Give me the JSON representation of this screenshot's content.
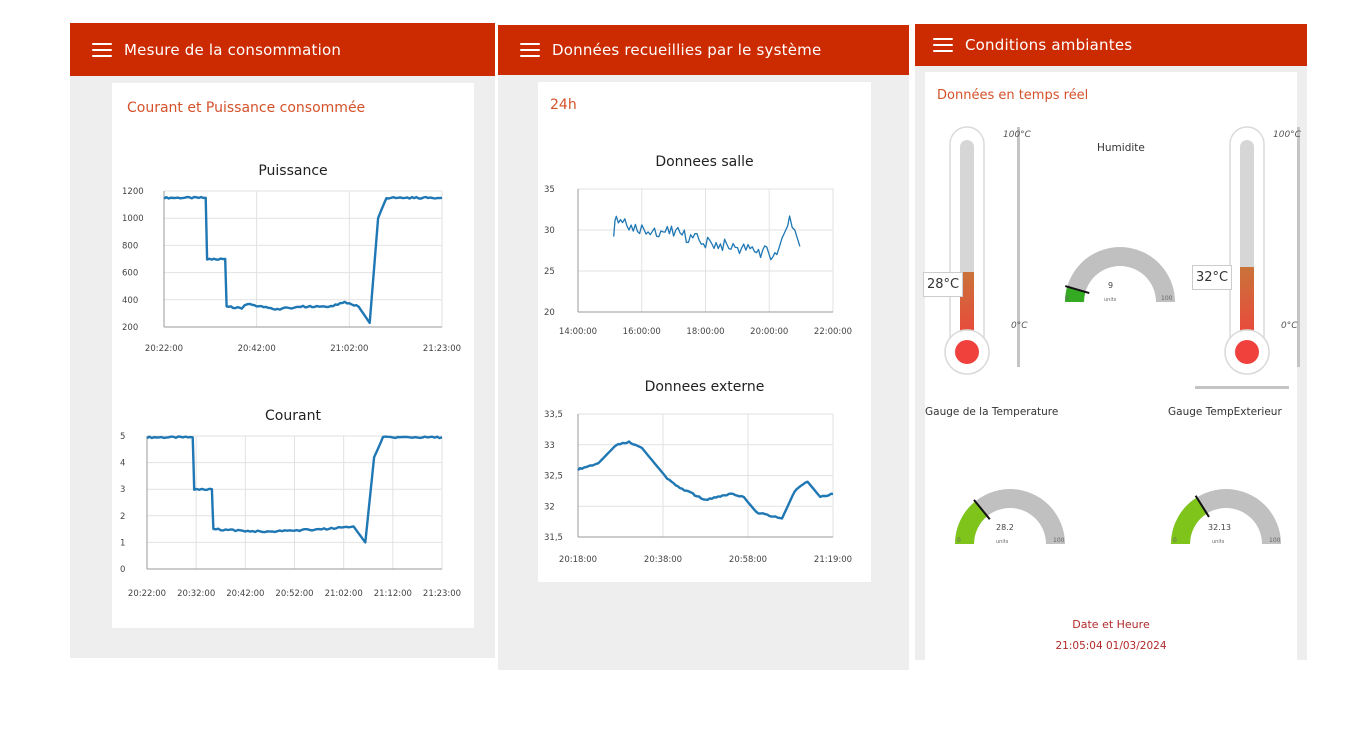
{
  "panels": [
    {
      "toolbar": {
        "title": "Mesure de la consommation"
      },
      "card_title": "Courant et Puissance consommée",
      "charts": [
        "Puissance",
        "Courant"
      ]
    },
    {
      "toolbar": {
        "title": "Données recueillies par le système"
      },
      "card_title": "24h",
      "charts": [
        "Donnees salle",
        "Donnees externe"
      ]
    },
    {
      "toolbar": {
        "title": "Conditions ambiantes"
      },
      "card_title": "Données en temps réel",
      "thermometers": [
        {
          "label": "28°C",
          "value": 28,
          "max_label": "100°C",
          "min_label": "0°C"
        },
        {
          "label": "32°C",
          "value": 32,
          "max_label": "100°C",
          "min_label": "0°C"
        }
      ],
      "gauges": [
        {
          "title": "Humidite",
          "value": "9",
          "units": "units",
          "min": "0",
          "max": "100",
          "color": "#33aa22"
        },
        {
          "title": "Gauge de la Temperature",
          "value": "28.2",
          "units": "units",
          "min": "0",
          "max": "100",
          "color": "#7fc41a"
        },
        {
          "title": "Gauge TempExterieur",
          "value": "32.13",
          "units": "units",
          "min": "0",
          "max": "100",
          "color": "#7fc41a"
        }
      ],
      "datetime": {
        "label": "Date et Heure",
        "value": "21:05:04 01/03/2024"
      }
    }
  ],
  "colors": {
    "toolbar": "#cc2a00",
    "accent": "#d4522a",
    "line": "#1f77b4",
    "gauge_track": "#c0c0c0"
  },
  "chart_data": [
    {
      "type": "line",
      "title": "Puissance",
      "x_ticks": [
        "20:22:00",
        "20:42:00",
        "21:02:00",
        "21:23:00"
      ],
      "y_ticks": [
        "1200",
        "1000",
        "800",
        "600",
        "400",
        "200"
      ],
      "ylim": [
        200,
        1200
      ],
      "series": [
        {
          "x": [
            0,
            0.15,
            0.155,
            0.22,
            0.225,
            0.28,
            0.3,
            0.4,
            0.5,
            0.6,
            0.65,
            0.7,
            0.74,
            0.77,
            0.8,
            1.0
          ],
          "values": [
            1150,
            1150,
            700,
            700,
            350,
            340,
            370,
            330,
            350,
            350,
            380,
            350,
            230,
            1000,
            1150,
            1150
          ]
        }
      ]
    },
    {
      "type": "line",
      "title": "Courant",
      "x_ticks": [
        "20:22:00",
        "20:32:00",
        "20:42:00",
        "20:52:00",
        "21:02:00",
        "21:12:00",
        "21:23:00"
      ],
      "y_ticks": [
        "5",
        "4",
        "3",
        "2",
        "1",
        "0"
      ],
      "ylim": [
        0,
        5
      ],
      "series": [
        {
          "x": [
            0,
            0.155,
            0.16,
            0.22,
            0.225,
            0.3,
            0.4,
            0.5,
            0.6,
            0.7,
            0.74,
            0.77,
            0.8,
            1.0
          ],
          "values": [
            4.95,
            4.95,
            3.0,
            3.0,
            1.5,
            1.45,
            1.4,
            1.45,
            1.5,
            1.6,
            1.0,
            4.2,
            4.95,
            4.95
          ]
        }
      ]
    },
    {
      "type": "line",
      "title": "Donnees salle",
      "x_ticks": [
        "14:00:00",
        "16:00:00",
        "18:00:00",
        "20:00:00",
        "22:00:00"
      ],
      "y_ticks": [
        "35",
        "30",
        "25",
        "20"
      ],
      "ylim": [
        20,
        35
      ],
      "series": [
        {
          "x": [
            0.14,
            0.15,
            0.2,
            0.3,
            0.4,
            0.5,
            0.6,
            0.7,
            0.78,
            0.8,
            0.83,
            0.85,
            0.87
          ],
          "values": [
            30,
            31,
            30.5,
            30,
            29.5,
            28.5,
            28,
            27.5,
            27,
            29,
            31,
            30,
            28
          ]
        }
      ]
    },
    {
      "type": "line",
      "title": "Donnees externe",
      "x_ticks": [
        "20:18:00",
        "20:38:00",
        "20:58:00",
        "21:19:00"
      ],
      "y_ticks": [
        "33,5",
        "33",
        "32,5",
        "32",
        "31,5"
      ],
      "ylim": [
        31.5,
        33.5
      ],
      "series": [
        {
          "x": [
            0,
            0.08,
            0.15,
            0.2,
            0.25,
            0.3,
            0.35,
            0.4,
            0.45,
            0.5,
            0.55,
            0.6,
            0.65,
            0.7,
            0.75,
            0.8,
            0.85,
            0.9,
            0.95,
            1.0
          ],
          "values": [
            32.6,
            32.7,
            33.0,
            33.05,
            32.95,
            32.7,
            32.45,
            32.3,
            32.2,
            32.1,
            32.15,
            32.2,
            32.15,
            31.9,
            31.85,
            31.8,
            32.25,
            32.4,
            32.15,
            32.2
          ]
        }
      ]
    }
  ]
}
